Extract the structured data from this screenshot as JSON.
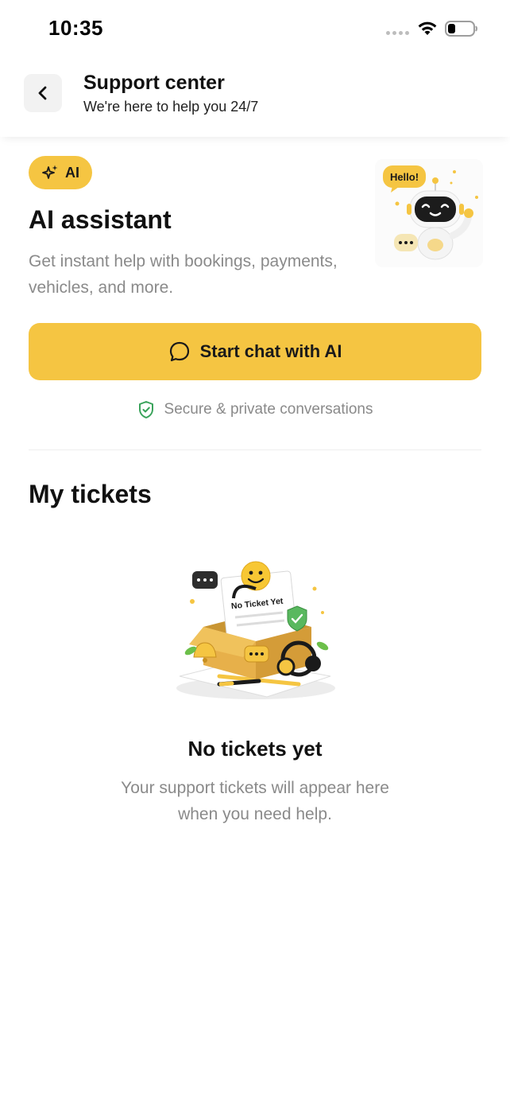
{
  "status_bar": {
    "time": "10:35"
  },
  "header": {
    "title": "Support center",
    "subtitle": "We're here to help you 24/7",
    "back_icon": "chevron-left-icon"
  },
  "ai_section": {
    "badge_label": "AI",
    "badge_icon": "sparkles-icon",
    "title": "AI assistant",
    "description": "Get instant help with bookings, payments, vehicles, and more.",
    "illustration_bubble_text": "Hello!",
    "chat_button_label": "Start chat with AI",
    "chat_button_icon": "chat-bubble-icon",
    "secure_note": "Secure & private conversations",
    "secure_icon": "shield-check-icon"
  },
  "tickets": {
    "title": "My tickets",
    "illustration_text": "No Ticket Yet",
    "empty_title": "No tickets yet",
    "empty_desc_line1": "Your support tickets will appear here",
    "empty_desc_line2": "when you need help."
  },
  "colors": {
    "accent": "#f5c542",
    "muted_text": "#8a8a8a",
    "secure_green": "#3aa35b",
    "background": "#ffffff"
  }
}
